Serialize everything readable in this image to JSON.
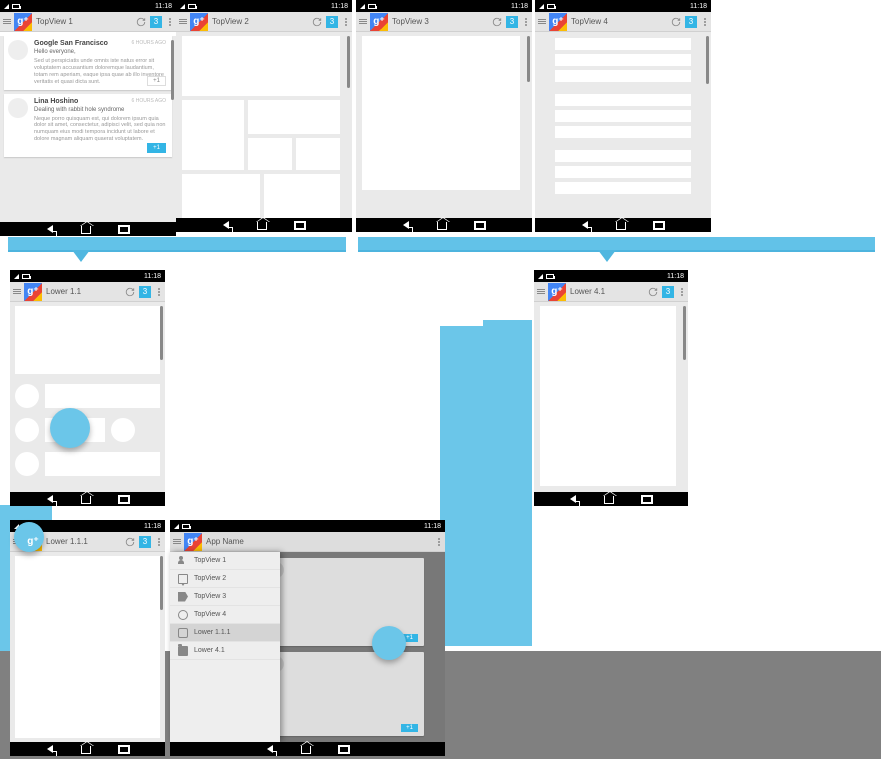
{
  "status": {
    "time": "11:18"
  },
  "badge": "3",
  "top": [
    {
      "title": "TopView 1"
    },
    {
      "title": "TopView 2"
    },
    {
      "title": "TopView 3"
    },
    {
      "title": "TopView 4"
    }
  ],
  "lower": {
    "l11": "Lower 1.1",
    "l41": "Lower 4.1",
    "l111": "Lower 1.1.1",
    "appname": "App Name"
  },
  "cards": [
    {
      "name": "Google San Francisco",
      "time": "6 HOURS AGO",
      "greeting": "Hello everyone,",
      "body": "Sed ut perspiciatis unde omnis iste natus error sit voluptatem accusantium doloremque laudantium, totam rem aperiam, eaque ipsa quae ab illo inventore veritatis et quasi dicta sunt.",
      "plus1": "+1"
    },
    {
      "name": "Lina Hoshino",
      "time": "6 HOURS AGO",
      "greeting": "Dealing with rabbit hole syndrome",
      "body": "Neque porro quisquam est, qui dolorem ipsum quia dolor sit amet, consectetur, adipisci velit, sed quia non numquam eius modi tempora incidunt ut labore et dolore magnam aliquam quaerat voluptatem.",
      "plus1": "+1"
    }
  ],
  "drawer": {
    "items": [
      {
        "label": "TopView 1",
        "icon": "people"
      },
      {
        "label": "TopView 2",
        "icon": "msg"
      },
      {
        "label": "TopView 3",
        "icon": "tag"
      },
      {
        "label": "TopView 4",
        "icon": "circ"
      },
      {
        "label": "Lower 1.1.1",
        "icon": "chat",
        "selected": true
      },
      {
        "label": "Lower 4.1",
        "icon": "folder"
      }
    ]
  },
  "behind": {
    "plus1": "+1"
  }
}
